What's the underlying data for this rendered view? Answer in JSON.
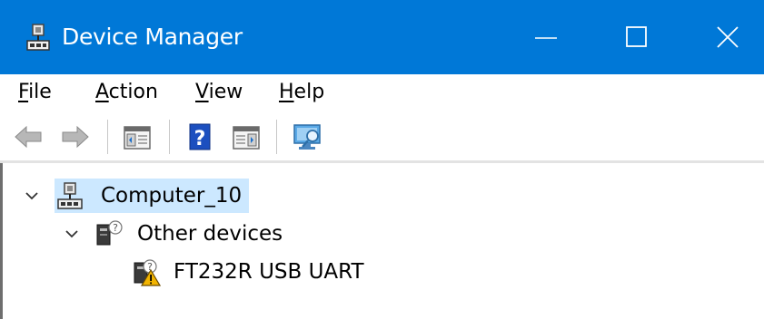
{
  "window": {
    "title": "Device Manager",
    "accent": "#0078d7"
  },
  "menu": {
    "items": [
      {
        "first": "F",
        "rest": "ile"
      },
      {
        "first": "A",
        "rest": "ction"
      },
      {
        "first": "V",
        "rest": "iew"
      },
      {
        "first": "H",
        "rest": "elp"
      }
    ]
  },
  "toolbar": {
    "buttons": [
      "back-icon",
      "forward-icon",
      "show-hide-console-tree-icon",
      "help-icon",
      "show-hide-action-pane-icon",
      "scan-hardware-icon"
    ]
  },
  "tree": {
    "root": {
      "label": "Computer_10",
      "expanded": true,
      "selected": true
    },
    "category": {
      "label": "Other devices",
      "expanded": true
    },
    "device": {
      "label": "FT232R USB UART",
      "status": "warning"
    }
  }
}
